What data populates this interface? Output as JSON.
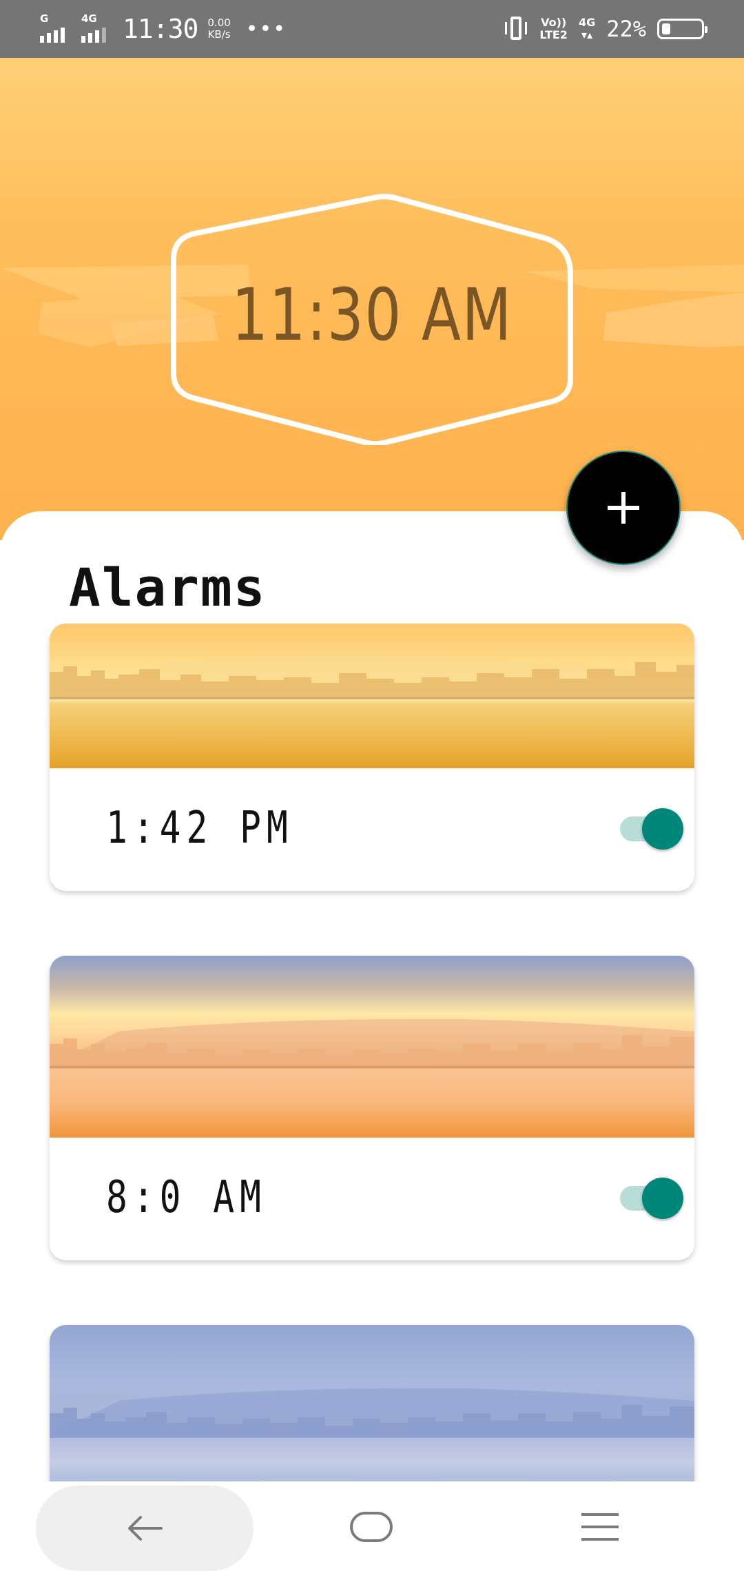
{
  "status_bar": {
    "signal1_label": "G",
    "signal2_label": "4G",
    "time": "11:30",
    "speed_value": "0.00",
    "speed_unit": "KB/s",
    "more": "•••",
    "volte_top": "Vo))",
    "volte_bottom": "LTE2",
    "net_top": "4G",
    "net_bottom": "▾▴",
    "battery_text": "22%",
    "battery_level": 0.22
  },
  "header": {
    "clock": "11:30 AM"
  },
  "fab": {
    "icon": "plus-icon"
  },
  "list": {
    "title": "Alarms",
    "alarms": [
      {
        "time": "1:42 PM",
        "enabled": true,
        "scene": "golden-sky-city"
      },
      {
        "time": "8:0 AM",
        "enabled": true,
        "scene": "sunrise-city"
      },
      {
        "scene": "blue-sky-city"
      }
    ]
  },
  "nav": {
    "back_icon": "back-arrow-icon",
    "home_icon": "home-icon",
    "menu_icon": "menu-icon"
  },
  "colors": {
    "header_bg": "#ffb754",
    "clock_text": "#7a5526",
    "fab_bg": "#000000",
    "toggle_thumb": "#00877a",
    "toggle_track": "#b8dcd6"
  }
}
